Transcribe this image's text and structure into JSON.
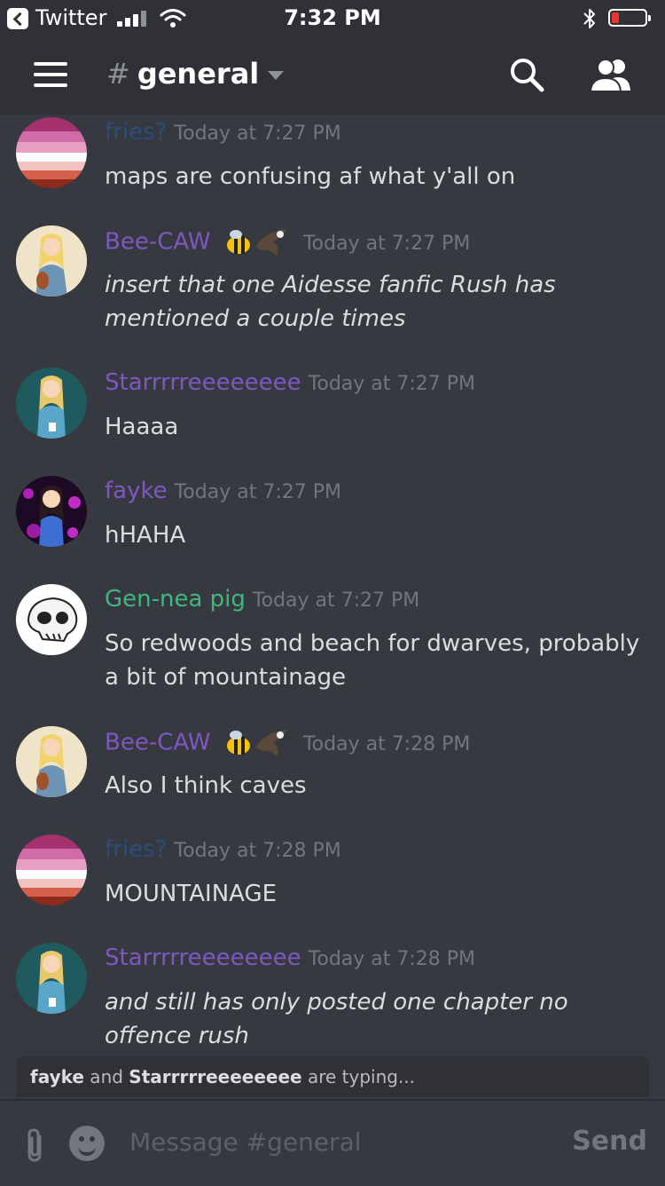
{
  "status_bar": {
    "back_app": "Twitter",
    "time": "7:32 PM"
  },
  "header": {
    "hash": "#",
    "channel": "general"
  },
  "messages": [
    {
      "user": "fries?",
      "color": "#2a4d7a",
      "timestamp": "Today at 7:27 PM",
      "text": "maps are confusing af what y'all on",
      "italic": false,
      "avatar": "stripes-flag"
    },
    {
      "user": "Bee-CAW",
      "color": "#7e57c2",
      "timestamp": "Today at 7:27 PM",
      "text": "insert that one Aidesse fanfic Rush has mentioned a couple times",
      "italic": true,
      "avatar": "girl-violin",
      "emoji": [
        "bee-emoji",
        "eagle-emoji"
      ]
    },
    {
      "user": "Starrrrreeeeeeee",
      "color": "#7e57c2",
      "timestamp": "Today at 7:27 PM",
      "text": "Haaaa",
      "italic": false,
      "avatar": "girl-teal"
    },
    {
      "user": "fayke",
      "color": "#7e57c2",
      "timestamp": "Today at 7:27 PM",
      "text": "hHAHA",
      "italic": false,
      "avatar": "girl-purple"
    },
    {
      "user": "Gen-nea pig",
      "color": "#43b581",
      "timestamp": "Today at 7:27 PM",
      "text": "So redwoods and beach for dwarves, probably a bit of mountainage",
      "italic": false,
      "avatar": "skull"
    },
    {
      "user": "Bee-CAW",
      "color": "#7e57c2",
      "timestamp": "Today at 7:28 PM",
      "text": "Also I think caves",
      "italic": false,
      "avatar": "girl-violin",
      "emoji": [
        "bee-emoji",
        "eagle-emoji"
      ]
    },
    {
      "user": "fries?",
      "color": "#2a4d7a",
      "timestamp": "Today at 7:28 PM",
      "text": "MOUNTAINAGE",
      "italic": false,
      "avatar": "stripes-flag"
    },
    {
      "user": "Starrrrreeeeeeee",
      "color": "#7e57c2",
      "timestamp": "Today at 7:28 PM",
      "text": "and still has only posted one chapter no offence rush",
      "italic": true,
      "avatar": "girl-teal"
    }
  ],
  "typing": {
    "user1": "fayke",
    "and": " and ",
    "user2": "Starrrrreeeeeeee",
    "suffix": " are typing..."
  },
  "composer": {
    "placeholder": "Message #general",
    "send_label": "Send"
  }
}
